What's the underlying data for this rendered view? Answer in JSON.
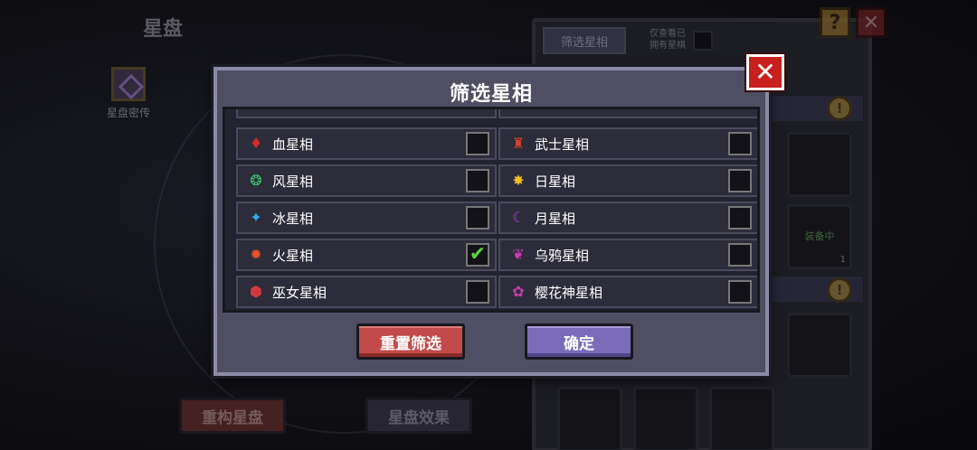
{
  "background": {
    "title": "星盘",
    "legacy_label": "星盘密传",
    "rebuild_button": "重构星盘",
    "effect_button": "星盘效果",
    "panel_tab": "筛选星相",
    "panel_owned_only": "仅查看已拥有星棋",
    "equipped_label": "装备中",
    "equipped_count": "1",
    "help_glyph": "?",
    "close_glyph": "✕",
    "coin_glyph": "!"
  },
  "modal": {
    "title": "筛选星相",
    "close_glyph": "✕",
    "reset_button": "重置筛选",
    "confirm_button": "确定",
    "check_glyph": "✔",
    "options_left": [
      {
        "label": "血星相",
        "icon": "blood-drop-icon",
        "glyph": "♦",
        "color": "#d42a2a",
        "checked": false
      },
      {
        "label": "风星相",
        "icon": "wind-swirl-icon",
        "glyph": "❂",
        "color": "#3fc46a",
        "checked": false
      },
      {
        "label": "冰星相",
        "icon": "ice-crystal-icon",
        "glyph": "✦",
        "color": "#3aa8f0",
        "checked": false
      },
      {
        "label": "火星相",
        "icon": "fire-icon",
        "glyph": "✹",
        "color": "#e8542a",
        "checked": true
      },
      {
        "label": "巫女星相",
        "icon": "witch-hat-icon",
        "glyph": "⬢",
        "color": "#d23a3a",
        "checked": false
      }
    ],
    "options_right": [
      {
        "label": "武士星相",
        "icon": "samurai-helmet-icon",
        "glyph": "♜",
        "color": "#d2442a",
        "checked": false
      },
      {
        "label": "日星相",
        "icon": "sun-icon",
        "glyph": "✸",
        "color": "#f0c020",
        "checked": false
      },
      {
        "label": "月星相",
        "icon": "moon-icon",
        "glyph": "☾",
        "color": "#b040e0",
        "checked": false
      },
      {
        "label": "乌鸦星相",
        "icon": "crow-icon",
        "glyph": "❦",
        "color": "#c83ab8",
        "checked": false
      },
      {
        "label": "樱花神星相",
        "icon": "sakura-icon",
        "glyph": "✿",
        "color": "#c83aa8",
        "checked": false
      }
    ],
    "checked_color": "#5cd03a"
  }
}
